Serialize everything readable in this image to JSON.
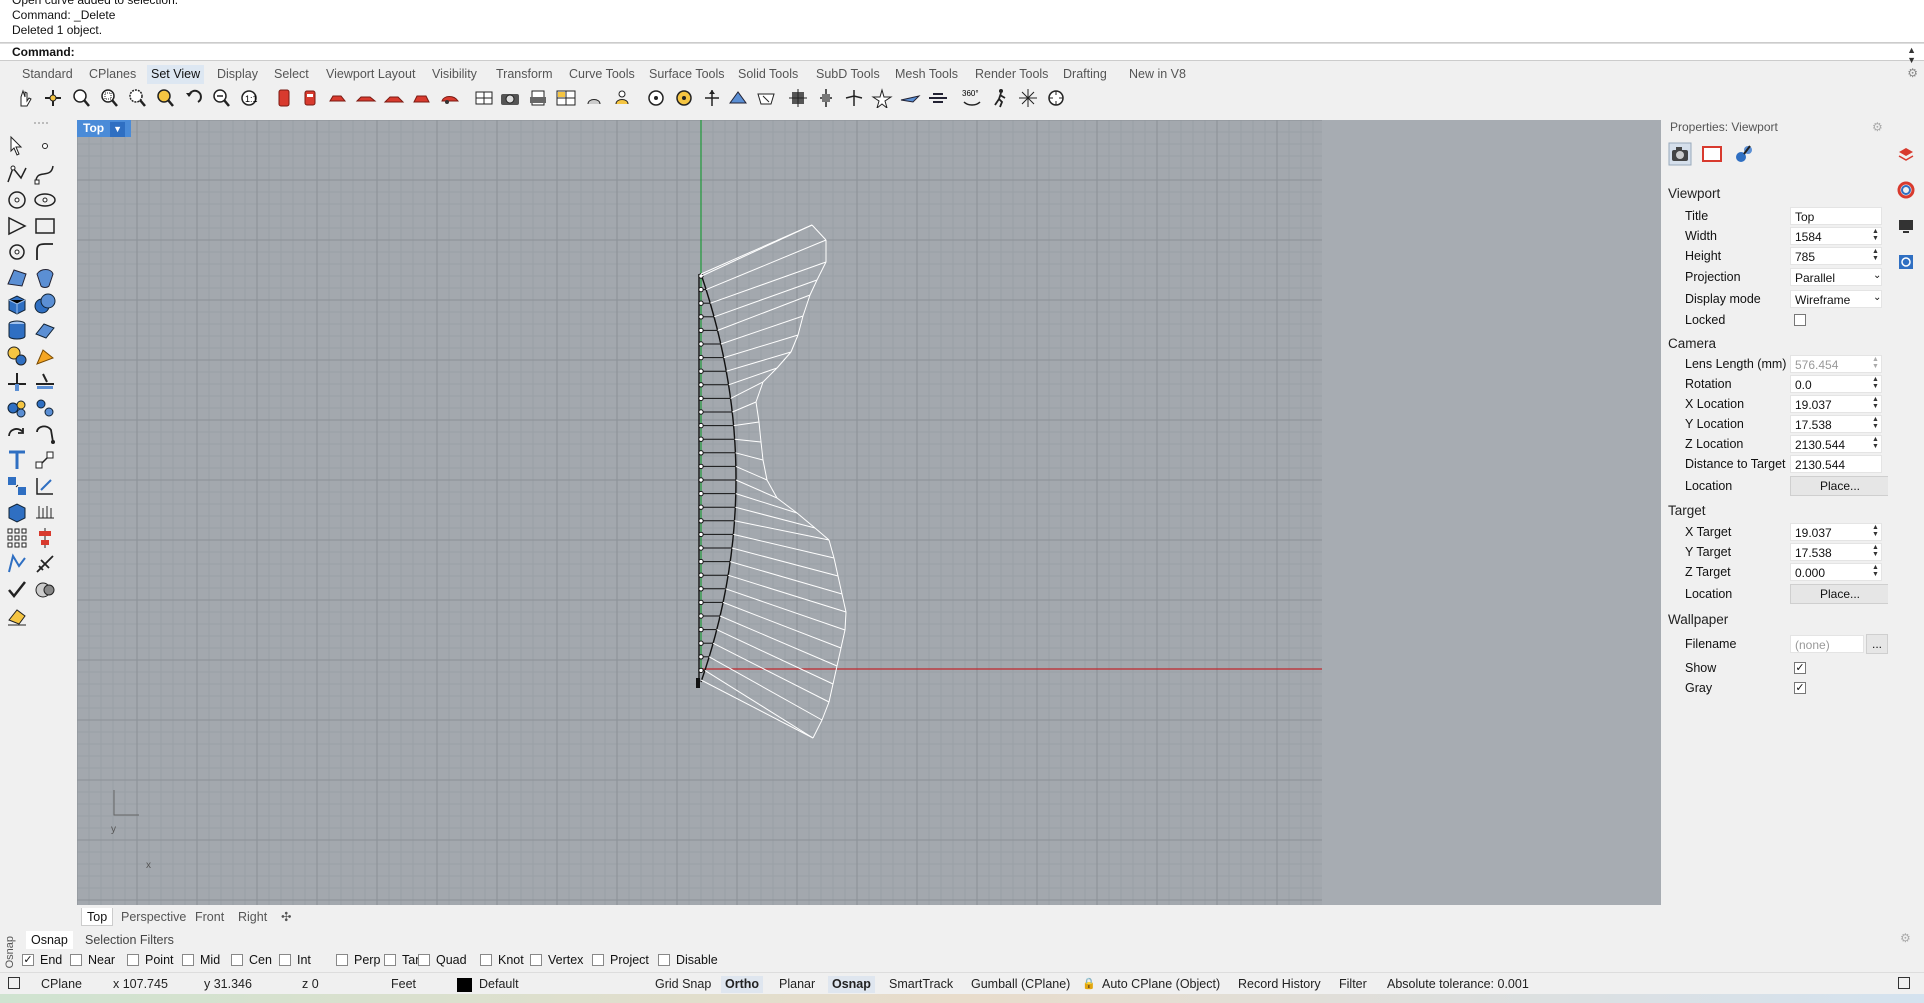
{
  "command": {
    "history": [
      "Open curve added to selection.",
      "Command: _Delete",
      "Deleted 1 object."
    ],
    "prompt_label": "Command:"
  },
  "tabs": [
    "Standard",
    "CPlanes",
    "Set View",
    "Display",
    "Select",
    "Viewport Layout",
    "Visibility",
    "Transform",
    "Curve Tools",
    "Surface Tools",
    "Solid Tools",
    "SubD Tools",
    "Mesh Tools",
    "Render Tools",
    "Drafting",
    "New in V8"
  ],
  "active_tab": "Set View",
  "viewport": {
    "name": "Top",
    "axis_x": "x",
    "axis_y": "y",
    "tabs": [
      "Top",
      "Perspective",
      "Front",
      "Right"
    ]
  },
  "properties": {
    "title": "Properties: Viewport",
    "sections": {
      "viewport": "Viewport",
      "camera": "Camera",
      "target": "Target",
      "wallpaper": "Wallpaper"
    },
    "viewport_rows": [
      {
        "label": "Title",
        "value": "Top"
      },
      {
        "label": "Width",
        "value": "1584"
      },
      {
        "label": "Height",
        "value": "785"
      },
      {
        "label": "Projection",
        "value": "Parallel"
      },
      {
        "label": "Display mode",
        "value": "Wireframe"
      },
      {
        "label": "Locked",
        "value": ""
      }
    ],
    "camera_rows": [
      {
        "label": "Lens Length (mm)",
        "value": "576.454"
      },
      {
        "label": "Rotation",
        "value": "0.0"
      },
      {
        "label": "X Location",
        "value": "19.037"
      },
      {
        "label": "Y Location",
        "value": "17.538"
      },
      {
        "label": "Z Location",
        "value": "2130.544"
      },
      {
        "label": "Distance to Target",
        "value": "2130.544"
      },
      {
        "label": "Location",
        "value": "Place..."
      }
    ],
    "target_rows": [
      {
        "label": "X Target",
        "value": "19.037"
      },
      {
        "label": "Y Target",
        "value": "17.538"
      },
      {
        "label": "Z Target",
        "value": "0.000"
      },
      {
        "label": "Location",
        "value": "Place..."
      }
    ],
    "wallpaper_rows": [
      {
        "label": "Filename",
        "value": "(none)"
      },
      {
        "label": "Show",
        "value": ""
      },
      {
        "label": "Gray",
        "value": ""
      }
    ],
    "ellipsis": "..."
  },
  "osnap": {
    "side_label": "Osnap",
    "tabs": [
      "Osnap",
      "Selection Filters"
    ],
    "items": [
      {
        "label": "End",
        "checked": true
      },
      {
        "label": "Near",
        "checked": false
      },
      {
        "label": "Point",
        "checked": false
      },
      {
        "label": "Mid",
        "checked": false
      },
      {
        "label": "Cen",
        "checked": false
      },
      {
        "label": "Int",
        "checked": false
      },
      {
        "label": "Perp",
        "checked": false
      },
      {
        "label": "Tan",
        "checked": false
      },
      {
        "label": "Quad",
        "checked": false
      },
      {
        "label": "Knot",
        "checked": false
      },
      {
        "label": "Vertex",
        "checked": false
      },
      {
        "label": "Project",
        "checked": false
      },
      {
        "label": "Disable",
        "checked": false
      }
    ]
  },
  "status": {
    "cplane": "CPlane",
    "x": "x 107.745",
    "y": "y 31.346",
    "z": "z 0",
    "units": "Feet",
    "layer": "Default",
    "grid_snap": "Grid Snap",
    "ortho": "Ortho",
    "planar": "Planar",
    "osnap": "Osnap",
    "smarttrack": "SmartTrack",
    "gumball": "Gumball (CPlane)",
    "auto_cplane": "Auto CPlane (Object)",
    "record_history": "Record History",
    "filter": "Filter",
    "tolerance": "Absolute tolerance: 0.001"
  },
  "colors": {
    "viewport_bg": "#a7acb2",
    "active_tab": "#4a8bd8",
    "x_axis": "#c0272d",
    "y_axis": "#1f9a3a"
  }
}
